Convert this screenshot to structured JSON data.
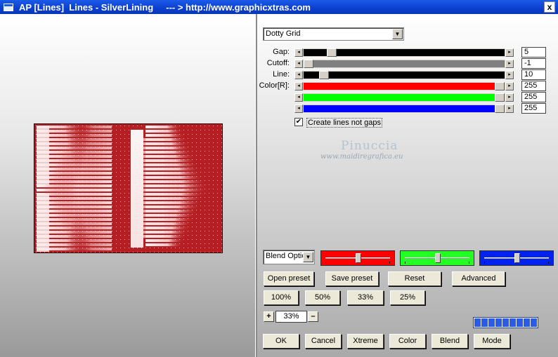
{
  "window": {
    "title": "AP [Lines]  Lines - SilverLining     --- > http://www.graphicxtras.com",
    "close_label": "x"
  },
  "preset": {
    "selected": "Dotty Grid"
  },
  "sliders": [
    {
      "label": "Gap:",
      "value": "5",
      "fill_color": "#000000",
      "level": 0.12
    },
    {
      "label": "Cutoff:",
      "value": "-1",
      "fill_color": "#808080",
      "level": 0.0
    },
    {
      "label": "Line:",
      "value": "10",
      "fill_color": "#000000",
      "level": 0.08
    },
    {
      "label": "Color[R]:",
      "value": "255",
      "fill_color": "#ff0000",
      "level": 1.0
    },
    {
      "label": "",
      "value": "255",
      "fill_color": "#00ff00",
      "level": 1.0
    },
    {
      "label": "",
      "value": "255",
      "fill_color": "#0000ff",
      "level": 1.0
    }
  ],
  "checkbox": {
    "label": "Create lines not gaps",
    "checked": true,
    "mark": "✔"
  },
  "watermark": {
    "name": "Pinuccia",
    "url": "www.maidiregrafica.eu"
  },
  "blend": {
    "selected": "Blend Optio"
  },
  "color_sliders": [
    {
      "color": "#ff0000",
      "level": 0.5
    },
    {
      "color": "#22ff22",
      "level": 0.5
    },
    {
      "color": "#0022ee",
      "level": 0.5
    }
  ],
  "buttons": {
    "open_preset": "Open preset",
    "save_preset": "Save preset",
    "reset": "Reset",
    "advanced": "Advanced",
    "zoom_100": "100%",
    "zoom_50": "50%",
    "zoom_33": "33%",
    "zoom_25": "25%",
    "ok": "OK",
    "cancel": "Cancel",
    "xtreme": "Xtreme",
    "color": "Color",
    "blend": "Blend",
    "mode": "Mode"
  },
  "zoom": {
    "plus": "+",
    "value": "33%",
    "minus": "–"
  },
  "progress": {
    "segments": 9
  },
  "colors": {
    "accent_title": "#0b3fcf",
    "canvas_red": "#b51f23"
  }
}
